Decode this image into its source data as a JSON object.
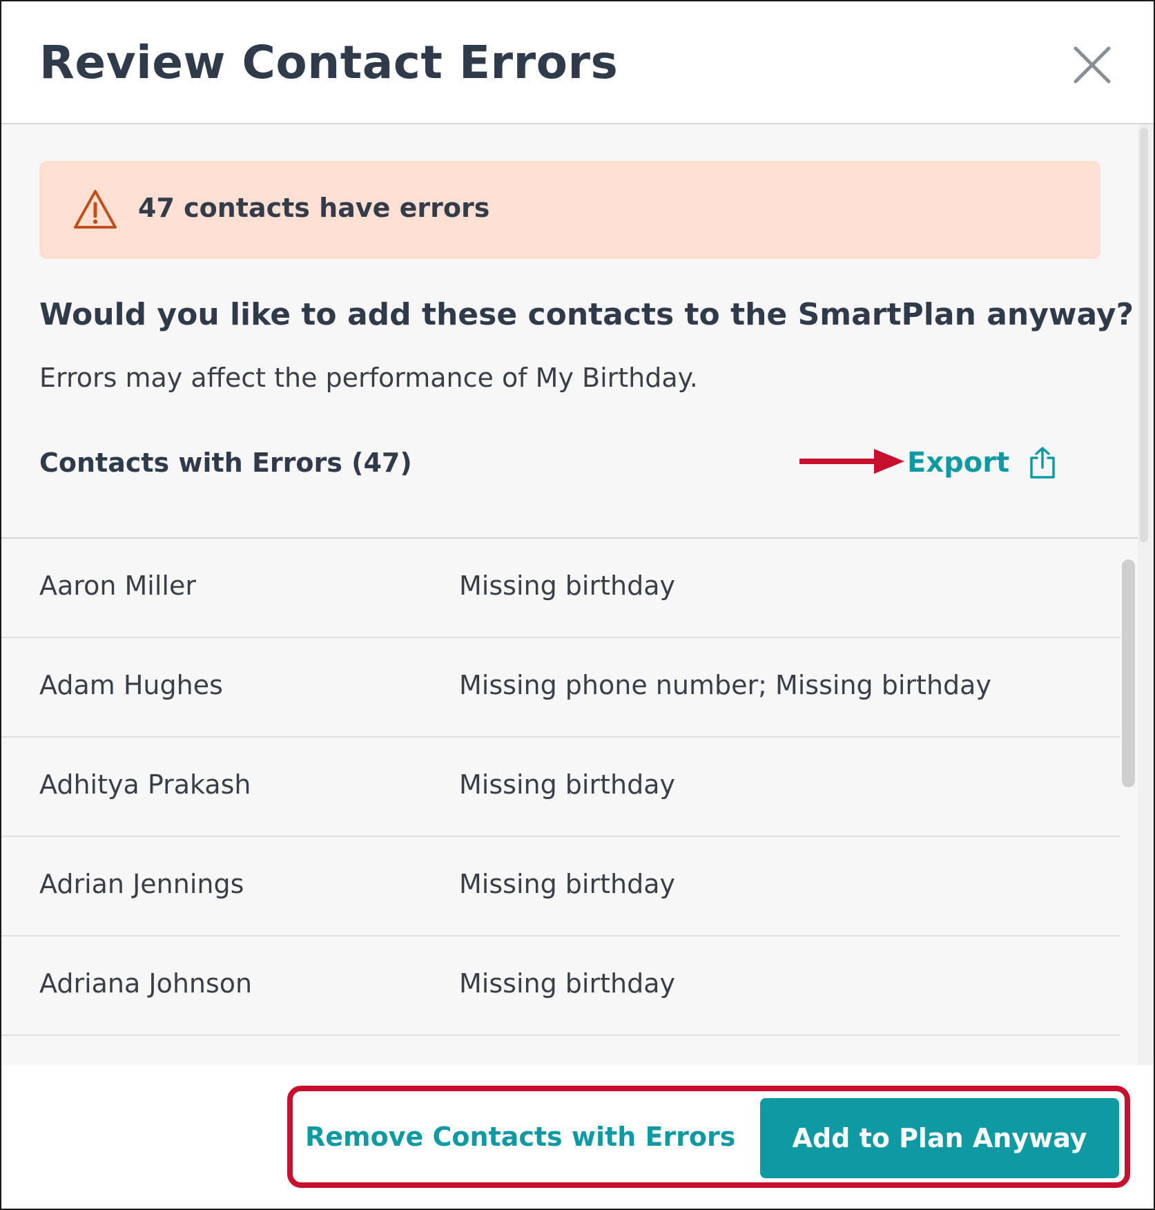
{
  "dialog": {
    "title": "Review Contact Errors",
    "close_icon": "close-icon"
  },
  "alert": {
    "icon": "warning-triangle-icon",
    "text": "47 contacts have errors",
    "background": "#fde0d3",
    "icon_color": "#c0501a"
  },
  "prompt": {
    "question": "Would you like to add these contacts to the SmartPlan anyway?",
    "subtext": "Errors may affect the performance of My Birthday."
  },
  "contacts_list": {
    "title": "Contacts with Errors (47)",
    "export_label": "Export",
    "export_icon": "share-export-icon",
    "annotation_arrow_icon": "red-arrow-icon",
    "rows": [
      {
        "name": "Aaron Miller",
        "error": "Missing birthday"
      },
      {
        "name": "Adam Hughes",
        "error": "Missing phone number; Missing birthday"
      },
      {
        "name": "Adhitya Prakash",
        "error": "Missing birthday"
      },
      {
        "name": "Adrian Jennings",
        "error": "Missing birthday"
      },
      {
        "name": "Adriana Johnson",
        "error": "Missing birthday"
      }
    ]
  },
  "footer": {
    "remove_label": "Remove Contacts with Errors",
    "add_label": "Add to Plan Anyway"
  },
  "colors": {
    "accent": "#0f9aa3",
    "annotation": "#c8102e",
    "heading": "#2f3a4a"
  }
}
